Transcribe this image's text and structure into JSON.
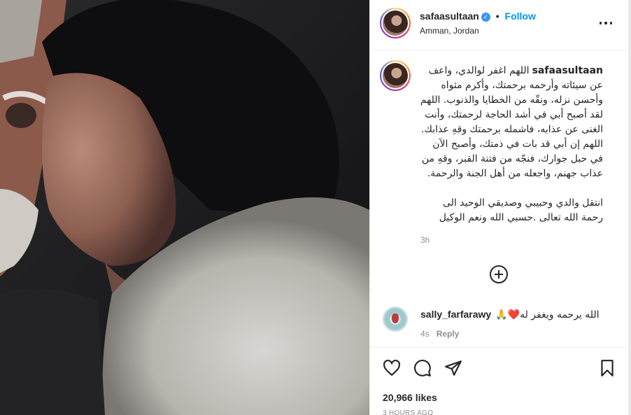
{
  "post": {
    "username": "safaasultaan",
    "verified_mark": "✓",
    "separator": "•",
    "follow_label": "Follow",
    "location": "Amman, Jordan",
    "caption": "اللهم اغفر لوالدي، واعف عن سيئاته وأرحمه برحمتك، وأكرم مثواه وأحسن نزله، ونقّه من الخطايا والذنوب. اللهم لقد أصبح أبي في أشد الحاجة لرحمتك، وأنت الغنى عن عذابه، فاشمله برحمتك وقهِ عذابك. اللهم إن أبي قد بات في ذمتك، وأصبح الآن في حبل جوارك، فنجّه من فتنة القبر، وقهِ من عذاب جهنم، واجعله من أهل الجنة والرحمة.\n\nانتقل والدي وحبيبي وصديقي الوحيد الى رحمة الله تعالى .حسبي الله ونعم الوكيل",
    "caption_time": "3h",
    "likes": "20,966 likes",
    "posted_ago": "3 HOURS AGO"
  },
  "comment": {
    "username": "sally_farfarawy",
    "text": "🙏❤️الله يرحمه ويغفر له",
    "time": "4s",
    "reply_label": "Reply"
  },
  "icons": {
    "more": "more-options-icon",
    "add": "plus-circle-icon",
    "like": "heart-icon",
    "comment": "comment-icon",
    "share": "send-icon",
    "save": "bookmark-icon"
  },
  "colors": {
    "accent": "#0095f6",
    "verified": "#3897f0",
    "muted": "#8e8e8e",
    "text": "#262626"
  }
}
